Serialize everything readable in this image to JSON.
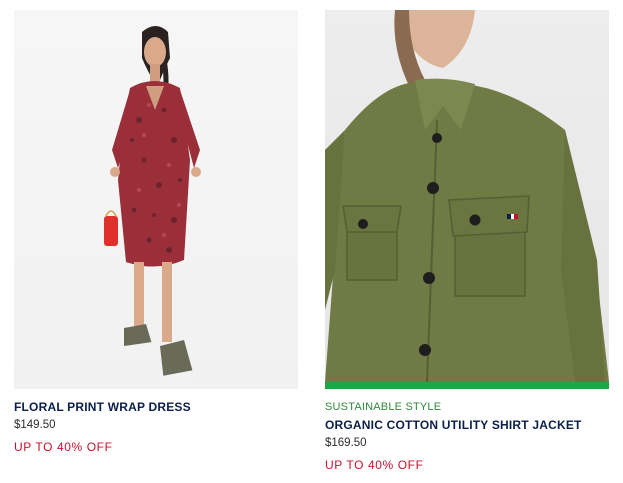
{
  "colors": {
    "title": "#0b1f4b",
    "discount": "#c8102e",
    "sustainable": "#2e8b3d",
    "sustainable_bar": "#22a447"
  },
  "products": [
    {
      "image_alt": "Model wearing floral print wrap dress",
      "title": "FLORAL PRINT WRAP DRESS",
      "price": "$149.50",
      "discount": "UP TO 40% OFF"
    },
    {
      "image_alt": "Model wearing olive organic cotton utility shirt jacket",
      "badge": "SUSTAINABLE STYLE",
      "title": "ORGANIC COTTON UTILITY SHIRT JACKET",
      "price": "$169.50",
      "discount": "UP TO 40% OFF"
    }
  ]
}
